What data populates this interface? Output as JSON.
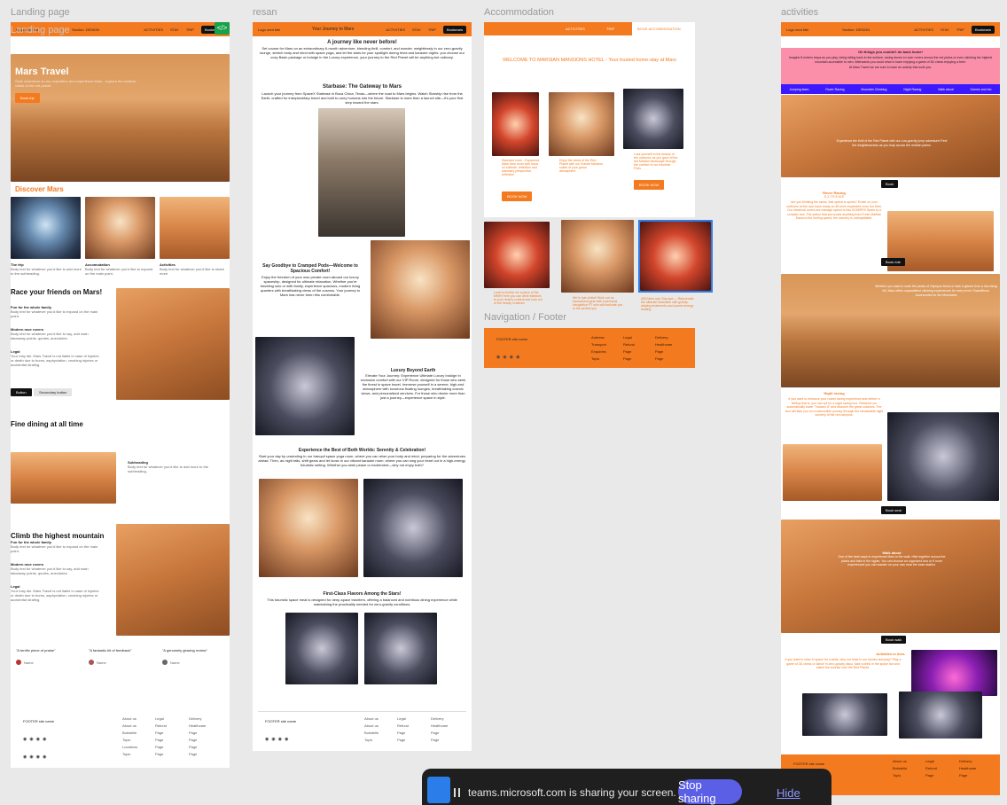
{
  "frames": {
    "landing": "Landing page",
    "resan": "resan",
    "accommodation": "Accommodation",
    "activities": "activities",
    "navfooter": "Navigation / Footer"
  },
  "landing": {
    "ghost_label": "Landing page",
    "nav_logo": "Logo med titel",
    "nav_center": "Section: DESIGN",
    "nav_links": [
      "ACTIVITIES",
      "STAY",
      "TRIP"
    ],
    "nav_cta": "Bookmars",
    "hero_title": "Mars Travel",
    "hero_sub": "Seek adventure on our expedition and experience Mars - explore the endless vistas of the red planet",
    "hero_btn": "Book trip",
    "discover": "Discover Mars",
    "cards": [
      {
        "title": "The trip",
        "body": "Body text for whatever you'd like to add more to the subheading."
      },
      {
        "title": "Accomodation",
        "body": "Body text for whatever you'd like to expand on the main point."
      },
      {
        "title": "Activities",
        "body": "Body text for whatever you'd like to share more."
      }
    ],
    "race_title": "Race your friends on Mars!",
    "race_items": [
      {
        "title": "Fun for the whole family",
        "body": "Body text for whatever you'd like to expand on the main point."
      },
      {
        "title": "Modern race rovers",
        "body": "Body text for whatever you'd like to say, add main takeaway points, quotes, anecdotes."
      },
      {
        "title": "Legal",
        "body": "Your may die. Mars Travel is not liable in case of injuries or death due to burns, asphyxiation, crushing injuries or accidental strafing."
      }
    ],
    "btn_primary": "Button",
    "btn_secondary": "Secondary button",
    "dining_title": "Fine dining at all time",
    "dining_sub": "Subheading",
    "dining_body": "Body text for whatever you'd like to add more to the subheading.",
    "climb_title": "Climb the highest mountain",
    "climb_items": [
      {
        "title": "Fun for the whole family",
        "body": "Body text for whatever you'd like to expand on the main point."
      },
      {
        "title": "Modern race rovers",
        "body": "Body text for whatever you'd like to say, add main takeaway points, quotes, anecdotes."
      },
      {
        "title": "Legal",
        "body": "Your may die. Mars Travel is not liable in case of injuries or death due to burns, asphyxiation, crushing injuries or accidental strafing."
      }
    ],
    "quotes": [
      {
        "q": "\"A terrific piece of praise\"",
        "name": "Name",
        "desc": "Description"
      },
      {
        "q": "\"A fantastic bit of feedback\"",
        "name": "Name",
        "desc": "Description"
      },
      {
        "q": "\"A genuinely glowing review\"",
        "name": "Name",
        "desc": "Description"
      }
    ],
    "footer_name": "FOOTER site name",
    "footer_cols": [
      [
        "About us",
        "About us",
        "Bokstelle",
        "Topic",
        "",
        "Locations",
        "Topic"
      ],
      [
        "Legal",
        "Refund",
        "Page",
        "Page",
        "",
        "Page",
        "Page"
      ],
      [
        "Delivery",
        "Healthcare",
        "Page",
        "Page",
        "",
        "Page",
        "Page"
      ]
    ]
  },
  "resan": {
    "nav_logo": "Logo med titel",
    "nav_center": "Your Journey to Mars",
    "nav_links": [
      "ACTIVITIES",
      "STAY",
      "TRIP"
    ],
    "nav_cta": "Bookmars",
    "h1": "A journey like never before!",
    "p1": "Set course for Mars on an extraordinary 6-month adventure, blending thrill, comfort, and wonder. weightlessly in our zero-gravity lounge, stretch body and mind with space yoga, and let the stars be your spotlight during trivia and karaoke nights. you choose our cozy Basic package or indulge in the Luxury experience, your journey to the Red Planet will be anything but ordinary.",
    "h2": "Starbase: The Gateway to Mars",
    "p2": "Launch your journey from SpaceX Starbase in Boca Chica, Texas—where the road to Mars begins. Watch Starship rise from the Earth, crafted for interplanetary travel and built to carry humans into the future. Starbase is more than a launch site—it's your first step toward the stars.",
    "h3": "Say Goodbye to Cramped Pods—Welcome to Spacious Comfort!",
    "p3": "Enjoy the freedom of your own private room aboard our luxury spaceship, designed for ultimate relaxation. Whether you're traveling solo or with family, experience spacious, modern living quarters with breathtaking views of the cosmos. Your journey to Mars has never been this comfortable.",
    "h4": "Luxury Beyond Earth",
    "p4": "Elevate Your Journey: Experience Ultimate Luxury Indulge in exclusive comfort with our VIP Room, designed for those who seek the finest in space travel. Immerse yourself in a serene, high-end atmosphere with luxurious floating lounges, breathtaking cosmic views, and personalized services. For those who desire more than just a journey—experience space in style.",
    "h5": "Experience the Best of Both Worlds: Serenity & Celebration!",
    "p5": "Start your day by unwinding in our tranquil space yoga room, where you can relax your body and mind, preparing for the adventures ahead. Then, as night falls, shift gears and let loose in our vibrant karaoke room, where you can sing your heart out in a high-energy, futuristic setting. Whether you seek peace or excitement—why not enjoy both?",
    "h6": "First-Class Flavors Among the Stars!",
    "p6": "This futuristic space meal is designed for deep-space travelers, offering a balanced and nutritious dining experience while maintaining the practicality needed for zero-gravity conditions.",
    "footer_name": "FOOTER site name",
    "footer_cols": [
      [
        "About us",
        "About us",
        "Bokstelle",
        "Topic"
      ],
      [
        "Legal",
        "Refund",
        "Page",
        "Page"
      ],
      [
        "Delivery",
        "Healthcare",
        "Page",
        "Page"
      ]
    ]
  },
  "accommodation": {
    "nav_links": [
      "ACTIVITIES",
      "TRIP"
    ],
    "nav_cta": "BOOK ACCOMMODATION",
    "welcome": "WELCOME TO MARSIAN MANSIONS HOTEL - Your trusted home-stay at Mars",
    "rooms": [
      "Standard room - Expansive Mars view room with focus on solitude, reflection and planetary perspective reflection",
      "Enjoy the views of the Red Planet with our Sunset Mansion suites of your grand atmosphere",
      "Lose yourself in the beauty of the unknown as you gaze at the red Martian landscape through the comfort of our futuristic Pods"
    ],
    "book_now": "BOOK NOW",
    "book_now2": "BOOK NOW",
    "rooms2": [
      "Look no further for a piece of the MMH! Here you can drink Marsinis to your heart's content and look out of the freshly Cratered",
      "We're just orbital! Work out as transparent gear with a personal Inkognition PT who will motivate you to the perfect you",
      "ABCMars spa: Day spa — Rejuvenate the ultimate relaxation with gravity-defying treatments and cosmic energy healing"
    ],
    "footer_name": "FOOTER site name",
    "footer_cols": [
      [
        "Address",
        "Transport",
        "Enquiries",
        "Topic"
      ],
      [
        "Legal",
        "Refund",
        "Page",
        "Page"
      ],
      [
        "Delivery",
        "Healthcare",
        "Page",
        "Page"
      ]
    ]
  },
  "activities": {
    "nav_logo": "Logo med titel",
    "nav_center": "Section: DESIGN",
    "nav_links": [
      "ACTIVITIES",
      "STAY",
      "TRIP"
    ],
    "nav_cta": "Bookmars",
    "intro_title": "Oh things you couldn't do back home!",
    "intro_body": "Imagine 8 meters leaps as you play, being falling back to the surface, racing dunes in rover rovers across the red plains or even climbing the highest mountain accessible to men. Afterwards you could relax in foam enjoying a game of 3D chess enjoying a beer.",
    "intro_body2": "At Mars Travel we are sure to have an activity that suits you.",
    "tabs": [
      "Jumping team",
      "Rover Racing",
      "Mountain Climbing",
      "Night Racing",
      "Walk about",
      "Games and fun"
    ],
    "jump_text": "Experience the thrill of the Red Planet with our Low-gravity jump adventure! Feel the weightlessness as you leap across the reddish plains.",
    "book_label": "Book",
    "rover_title": "Rover Racing",
    "rover_sub": "E.X.T.R.E.M.E",
    "rover_body": "Are you thinking the same, that speed is sports? Excite on your uniforms at the race track ready on 84 km/h expanded rover fun fleet. Our electrical rovers are manage speed to this SONRPHI Spark to a complex ace. The action that surrounds anything from Fresh Martian Mana to the hurling speed, the scenery is unforgettable.",
    "book_btn": "Book ride",
    "climb_text": "Whether you want to mark the peaks of Olympus Mons or take a glance from a low-rising hill, Mars offers unparalleled climbing experiences for every level. Expeditions. Accessories for the Mountains",
    "night_title": "Night racing",
    "night_body": "If you want to enhance your rocket racing experience and deliver a feeling that is, you can opt for a night racing tour. Reached our automatically tower \"Volcano 8\" and discover the great outdoors. The tour will take you on a memorable journey through the remarkable night scenery of the red canyons.",
    "book_seat": "Book seat",
    "walk_title": "Walk about",
    "walk_body": "One of the best ways to experience Mars is the walk. Hike together across the plains and take in the sights. You can choose an organized tour or if more experienced you can wander on your own near the base station.",
    "book_walk": "Book walk",
    "games_title": "Activities in Ares",
    "games_body": "If you want to relax in space for a while, why not relax in our domes and play? Play a game of 3D chess or dance in zero-gravity disco, take a drink in the space bar and watch the sunrise over the Red Planet.",
    "footer_name": "FOOTER site name",
    "footer_cols": [
      [
        "About us",
        "Bokstelle",
        "Topic"
      ],
      [
        "Legal",
        "Refund",
        "Page"
      ],
      [
        "Delivery",
        "Healthcare",
        "Page"
      ]
    ]
  },
  "sharebar": {
    "message": "teams.microsoft.com is sharing your screen.",
    "stop": "Stop sharing",
    "hide": "Hide"
  }
}
